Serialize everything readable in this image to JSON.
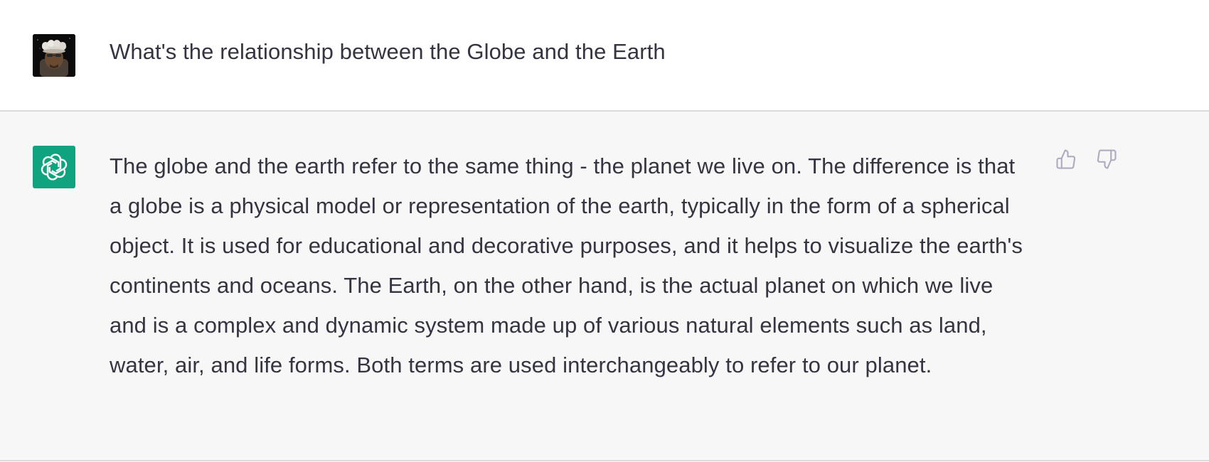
{
  "conversation": {
    "user_message": {
      "text": "What's the relationship between the Globe and the Earth"
    },
    "assistant_message": {
      "text": "The globe and the earth refer to the same thing - the planet we live on. The difference is that a globe is a physical model or representation of the earth, typically in the form of a spherical object. It is used for educational and decorative purposes, and it helps to visualize the earth's continents and oceans. The Earth, on the other hand, is the actual planet on which we live and is a complex and dynamic system made up of various natural elements such as land, water, air, and life forms. Both terms are used interchangeably to refer to our planet."
    }
  },
  "icons": {
    "user_avatar": "user-avatar-image",
    "assistant_avatar": "openai-logo-icon",
    "like": "thumbs-up-icon",
    "dislike": "thumbs-down-icon"
  },
  "colors": {
    "assistant_background": "#f7f7f8",
    "assistant_avatar_background": "#10a37f",
    "text": "#343541",
    "feedback_icon": "#acacbe"
  }
}
